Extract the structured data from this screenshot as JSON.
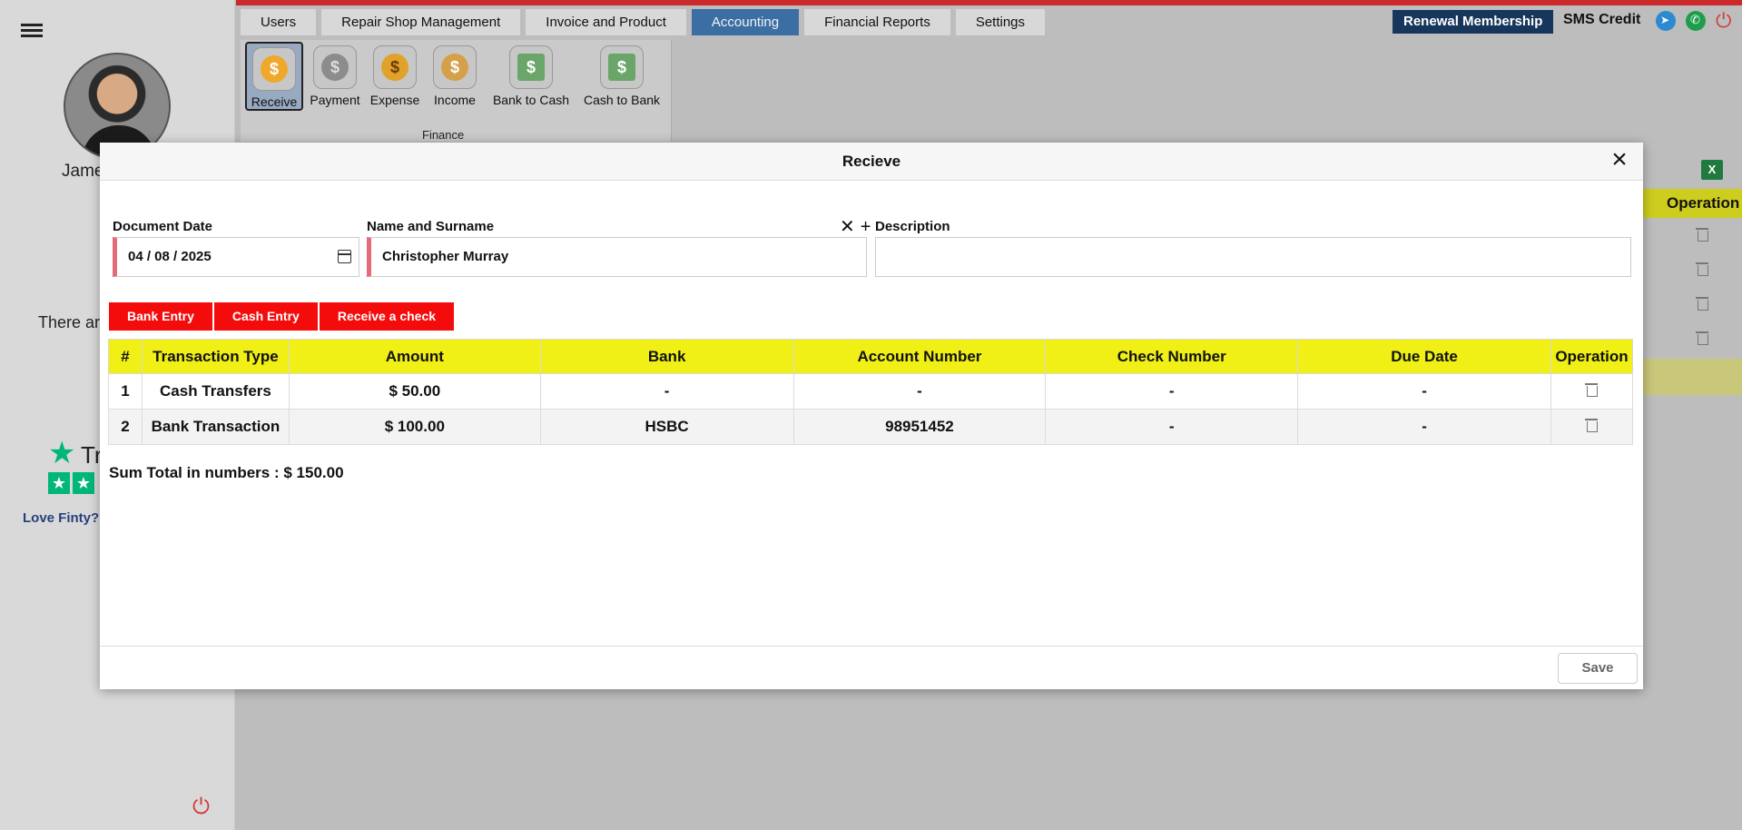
{
  "sidebar": {
    "user_name": "James",
    "notice_text": "There ar",
    "trust_text": "Tr",
    "love_text": "Love Finty?"
  },
  "topnav": {
    "tabs": [
      {
        "label": "Users"
      },
      {
        "label": "Repair Shop Management"
      },
      {
        "label": "Invoice and Product"
      },
      {
        "label": "Accounting",
        "active": true
      },
      {
        "label": "Financial Reports"
      },
      {
        "label": "Settings"
      }
    ],
    "renewal_label": "Renewal Membership",
    "sms_label": "SMS Credit"
  },
  "ribbon": {
    "items": [
      {
        "label": "Receive"
      },
      {
        "label": "Payment"
      },
      {
        "label": "Expense"
      },
      {
        "label": "Income"
      },
      {
        "label": "Bank to Cash"
      },
      {
        "label": "Cash to Bank"
      }
    ],
    "group_label": "Finance"
  },
  "background": {
    "operation_header": "Operation"
  },
  "modal": {
    "title": "Recieve",
    "document_date": {
      "label": "Document Date",
      "value": "04 / 08 / 2025"
    },
    "name": {
      "label": "Name and Surname",
      "value": "Christopher Murray"
    },
    "description": {
      "label": "Description",
      "value": ""
    },
    "entry_buttons": [
      "Bank Entry",
      "Cash Entry",
      "Receive a check"
    ],
    "table": {
      "headers": [
        "#",
        "Transaction Type",
        "Amount",
        "Bank",
        "Account Number",
        "Check Number",
        "Due Date",
        "Operation"
      ],
      "rows": [
        {
          "no": "1",
          "type": "Cash Transfers",
          "amount": "$ 50.00",
          "bank": "-",
          "account": "-",
          "check": "-",
          "due": "-"
        },
        {
          "no": "2",
          "type": "Bank Transaction",
          "amount": "$ 100.00",
          "bank": "HSBC",
          "account": "98951452",
          "check": "-",
          "due": "-"
        }
      ]
    },
    "sum_total": "Sum Total in numbers : $ 150.00",
    "save_label": "Save"
  },
  "colors": {
    "accent_tab": "#3b6ea2",
    "renewal_bg": "#17365b",
    "entry_button": "#f40c0c",
    "table_header": "#f0f016",
    "required_marker": "#e46b7a"
  }
}
